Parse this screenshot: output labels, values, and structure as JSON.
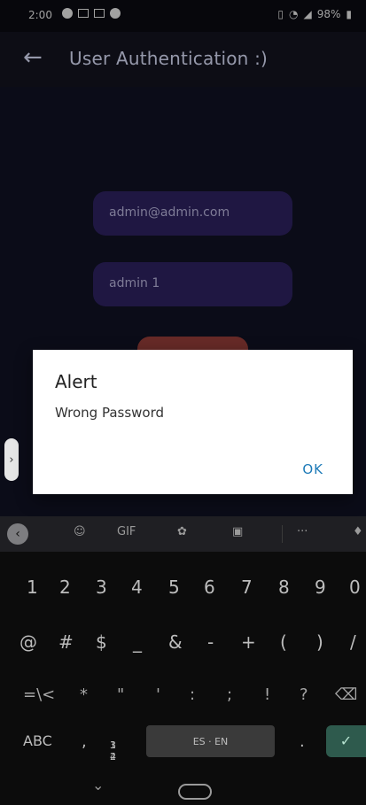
{
  "status_bar": {
    "time": "2:00",
    "battery": "98%"
  },
  "app_bar": {
    "back_icon": "arrow-left",
    "title": "User Authentication :)"
  },
  "form": {
    "email_value": "admin@admin.com",
    "password_value": "admin 1",
    "login_button_label": ""
  },
  "dialog": {
    "title": "Alert",
    "message": "Wrong Password",
    "ok_label": "OK"
  },
  "keyboard": {
    "toolbar": {
      "gif_label": "GIF",
      "more_label": "···"
    },
    "numbers": [
      "1",
      "2",
      "3",
      "4",
      "5",
      "6",
      "7",
      "8",
      "9",
      "0"
    ],
    "symbols": [
      "@",
      "#",
      "$",
      "_",
      "&",
      "-",
      "+",
      "(",
      ")",
      "/"
    ],
    "symbols2": [
      "=\\<",
      "*",
      "\"",
      "'",
      ":",
      ";",
      "!",
      "?"
    ],
    "abc_label": "ABC",
    "comma_label": ",",
    "numpad_top": "1 2",
    "numpad_bottom": "3 4",
    "space_label": "ES · EN",
    "period_label": ".",
    "enter_icon": "check"
  },
  "colors": {
    "field_bg": "#2a1f59",
    "button_bg": "#8a3934",
    "dialog_ok": "#1e7bb8"
  }
}
